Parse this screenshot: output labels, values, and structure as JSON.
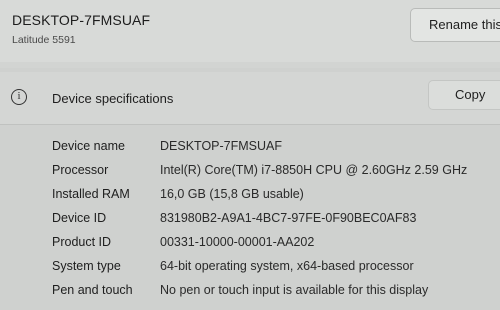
{
  "device": {
    "name": "DESKTOP-7FMSUAF",
    "model": "Latitude 5591",
    "rename_label": "Rename this"
  },
  "specs": {
    "title": "Device specifications",
    "copy_label": "Copy",
    "rows": [
      {
        "label": "Device name",
        "value": "DESKTOP-7FMSUAF"
      },
      {
        "label": "Processor",
        "value": "Intel(R) Core(TM) i7-8850H CPU @ 2.60GHz   2.59 GHz"
      },
      {
        "label": "Installed RAM",
        "value": "16,0 GB (15,8 GB usable)"
      },
      {
        "label": "Device ID",
        "value": "831980B2-A9A1-4BC7-97FE-0F90BEC0AF83"
      },
      {
        "label": "Product ID",
        "value": "00331-10000-00001-AA202"
      },
      {
        "label": "System type",
        "value": "64-bit operating system, x64-based processor"
      },
      {
        "label": "Pen and touch",
        "value": "No pen or touch input is available for this display"
      }
    ]
  },
  "icons": {
    "info": "info-icon"
  }
}
